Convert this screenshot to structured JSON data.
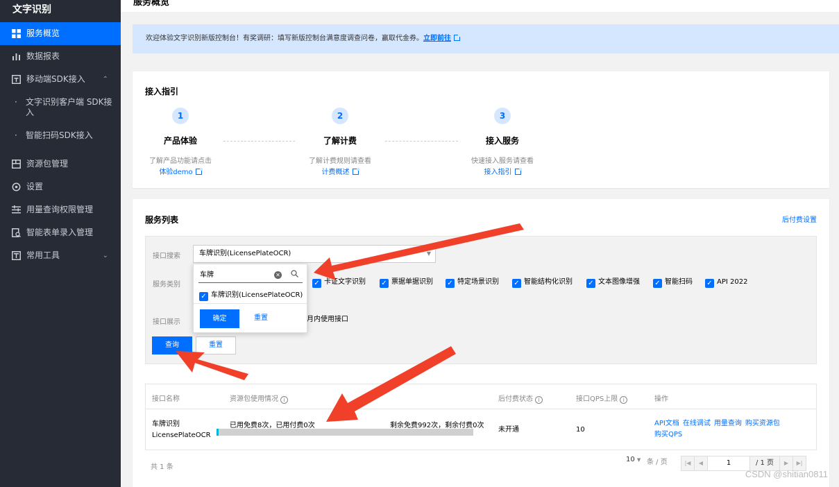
{
  "sidebar": {
    "title": "文字识别",
    "items": [
      {
        "label": "服务概览"
      },
      {
        "label": "数据报表"
      },
      {
        "label": "移动端SDK接入"
      },
      {
        "label": "资源包管理"
      },
      {
        "label": "设置"
      },
      {
        "label": "用量查询权限管理"
      },
      {
        "label": "智能表单录入管理"
      },
      {
        "label": "常用工具"
      }
    ],
    "sub_items": [
      {
        "label": "文字识别客户端 SDK接入"
      },
      {
        "label": "智能扫码SDK接入"
      }
    ],
    "dot": "·"
  },
  "page": {
    "title": "服务概览"
  },
  "banner": {
    "text": "欢迎体验文字识别新版控制台！有奖调研：填写新版控制台满意度调查问卷，赢取代金券。",
    "link": "立即前往"
  },
  "guide": {
    "title": "接入指引",
    "steps": [
      {
        "num": "1",
        "name": "产品体验",
        "desc": "了解产品功能请点击",
        "link": "体验demo"
      },
      {
        "num": "2",
        "name": "了解计费",
        "desc": "了解计费规则请查看",
        "link": "计费概述"
      },
      {
        "num": "3",
        "name": "接入服务",
        "desc": "快速接入服务请查看",
        "link": "接入指引"
      }
    ]
  },
  "services": {
    "title": "服务列表",
    "postpaid_settings": "后付费设置",
    "filter": {
      "search_label": "接口搜索",
      "search_value": "车牌识别(LicensePlateOCR)",
      "type_label": "服务类别",
      "display_label": "接口展示",
      "display_text": "月内使用接口",
      "categories": [
        "卡证文字识别",
        "票据单据识别",
        "特定场景识别",
        "智能结构化识别",
        "文本图像增强",
        "智能扫码",
        "API 2022"
      ],
      "query_button": "查询",
      "reset_button": "重置"
    },
    "dropdown": {
      "search_text": "车牌",
      "option": "车牌识别(LicensePlateOCR)",
      "confirm": "确定",
      "reset": "重置"
    },
    "table": {
      "headers": [
        "接口名称",
        "资源包使用情况",
        "后付费状态",
        "接口QPS上限",
        "操作"
      ],
      "row": {
        "name_line1": "车牌识别",
        "name_line2": "LicensePlateOCR",
        "used": "已用免费8次，已用付费0次",
        "remaining": "剩余免费992次，剩余付费0次",
        "usage_fraction": 0.008,
        "status": "未开通",
        "qps": "10",
        "actions": [
          "API文档",
          "在线调试",
          "用量查询",
          "购买资源包",
          "购买QPS"
        ]
      }
    },
    "pager": {
      "total": "共 1 条",
      "page_size": "10",
      "page_size_unit": "条 / 页",
      "current_page": "1",
      "total_pages": "/ 1 页"
    }
  },
  "watermark": "CSDN @shitian0811",
  "colors": {
    "primary": "#006eff",
    "sidebar": "#262b35",
    "banner": "#d5e7ff",
    "arrow": "#f0402a"
  }
}
